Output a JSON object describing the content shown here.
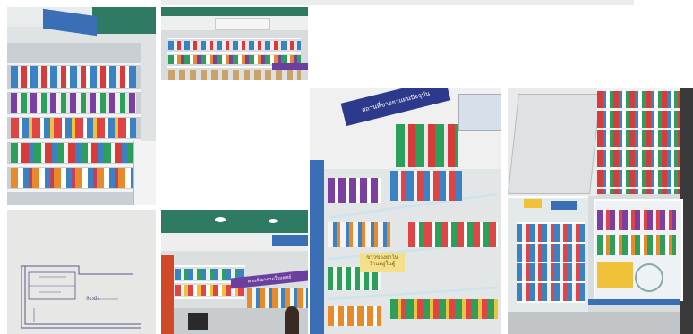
{
  "gallery": {
    "photos": [
      {
        "subject": "pharmacy-shelves-left-wall"
      },
      {
        "subject": "pharmacy-back-shelf"
      },
      {
        "subject": "floor-plan-sketch"
      },
      {
        "subject": "pharmacy-counter-view"
      },
      {
        "subject": "pharmacy-wall-display"
      },
      {
        "subject": "pharmacy-glass-counter"
      }
    ],
    "signs": {
      "photo4_banner": "ตามสั่งยาตามใบแพทย์",
      "photo5_banner": "สถานที่ขายยาแผนปัจจุบัน",
      "photo5_note": "ข้าวของยาในร้านอยู่ในตู้",
      "plan_note": "ห้องน้ำ"
    }
  },
  "colors": {
    "teal_ceiling": "#2e7a63",
    "blue_sign": "#2d3a8c",
    "shelf_white": "#f3f3f3"
  }
}
